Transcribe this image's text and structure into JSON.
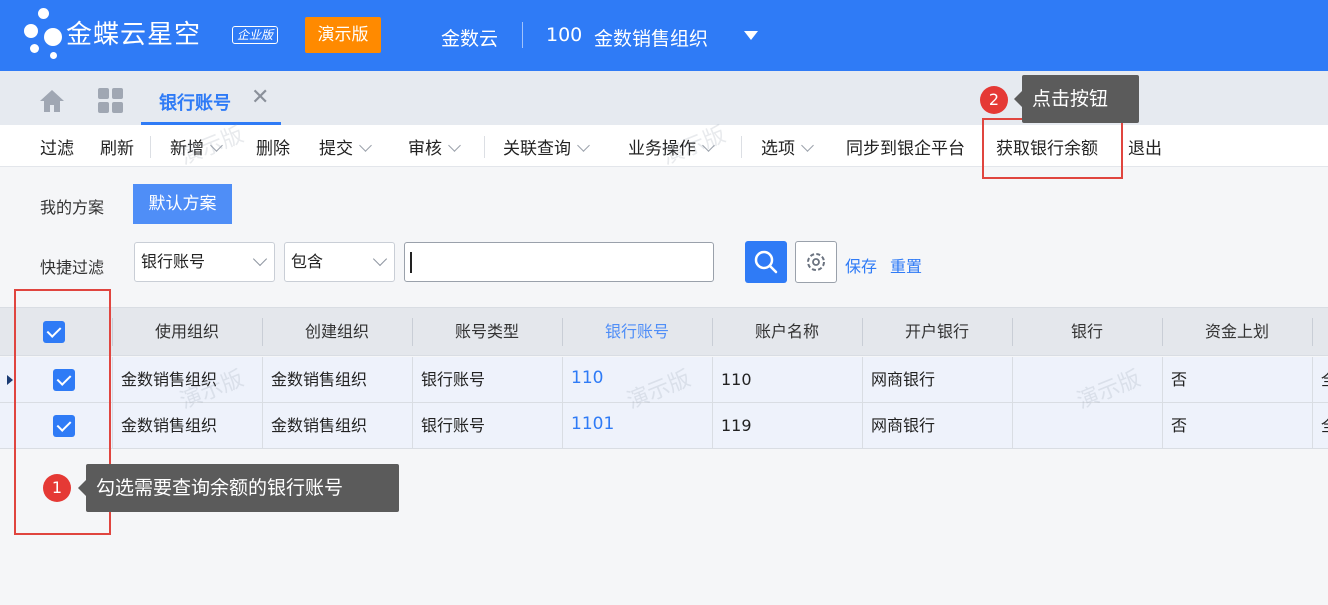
{
  "header": {
    "brand": "金蝶云",
    "brand_suffix": "星空",
    "edition": "企业版",
    "demo_badge": "演示版",
    "cloud": "金数云",
    "org_code": "100",
    "org_name": "金数销售组织"
  },
  "tabs": {
    "active_label": "银行账号",
    "close": "✕"
  },
  "toolbar": {
    "filter": "过滤",
    "refresh": "刷新",
    "add": "新增",
    "delete": "删除",
    "submit": "提交",
    "audit": "审核",
    "related_query": "关联查询",
    "business_ops": "业务操作",
    "options": "选项",
    "sync": "同步到银企平台",
    "get_balance": "获取银行余额",
    "exit": "退出"
  },
  "scheme": {
    "label": "我的方案",
    "default_btn": "默认方案"
  },
  "quick_filter": {
    "label": "快捷过滤",
    "field_value": "银行账号",
    "operator_value": "包含",
    "search_value": "",
    "save": "保存",
    "reset": "重置"
  },
  "grid": {
    "columns": [
      "使用组织",
      "创建组织",
      "账号类型",
      "银行账号",
      "账户名称",
      "开户银行",
      "银行",
      "资金上划"
    ],
    "rows": [
      {
        "use_org": "金数销售组织",
        "create_org": "金数销售组织",
        "account_type": "银行账号",
        "account_no": "110",
        "account_name": "110",
        "open_bank": "网商银行",
        "bank": "",
        "fund_up": "否",
        "more": "全"
      },
      {
        "use_org": "金数销售组织",
        "create_org": "金数销售组织",
        "account_type": "银行账号",
        "account_no": "1101",
        "account_name": "119",
        "open_bank": "网商银行",
        "bank": "",
        "fund_up": "否",
        "more": "全"
      }
    ]
  },
  "annotations": {
    "step1_num": "1",
    "step1_text": "勾选需要查询余额的银行账号",
    "step2_num": "2",
    "step2_text": "点击按钮"
  },
  "watermark": "演示版",
  "colors": {
    "brand_blue": "#2f7bf6",
    "demo_orange": "#ff8a00",
    "annotation_red": "#e0453f"
  }
}
